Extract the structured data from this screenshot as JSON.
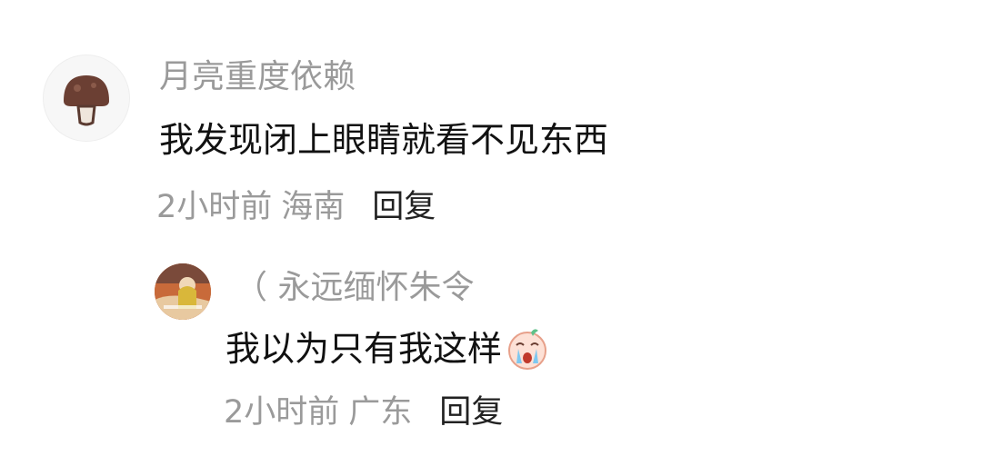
{
  "comment": {
    "username": "月亮重度依赖",
    "text": "我发现闭上眼睛就看不见东西",
    "time": "2小时前",
    "location": "海南",
    "reply_label": "回复",
    "avatar_icon": "mushroom-icon"
  },
  "reply": {
    "username": "（ 永远缅怀朱令",
    "text": "我以为只有我这样",
    "emoji": "crying-face-emoji",
    "time": "2小时前",
    "location": "广东",
    "reply_label": "回复",
    "avatar_icon": "photo-avatar"
  },
  "colors": {
    "username": "#9a9a9a",
    "text": "#111111",
    "meta": "#9a9a9a",
    "reply_button": "#222222"
  }
}
